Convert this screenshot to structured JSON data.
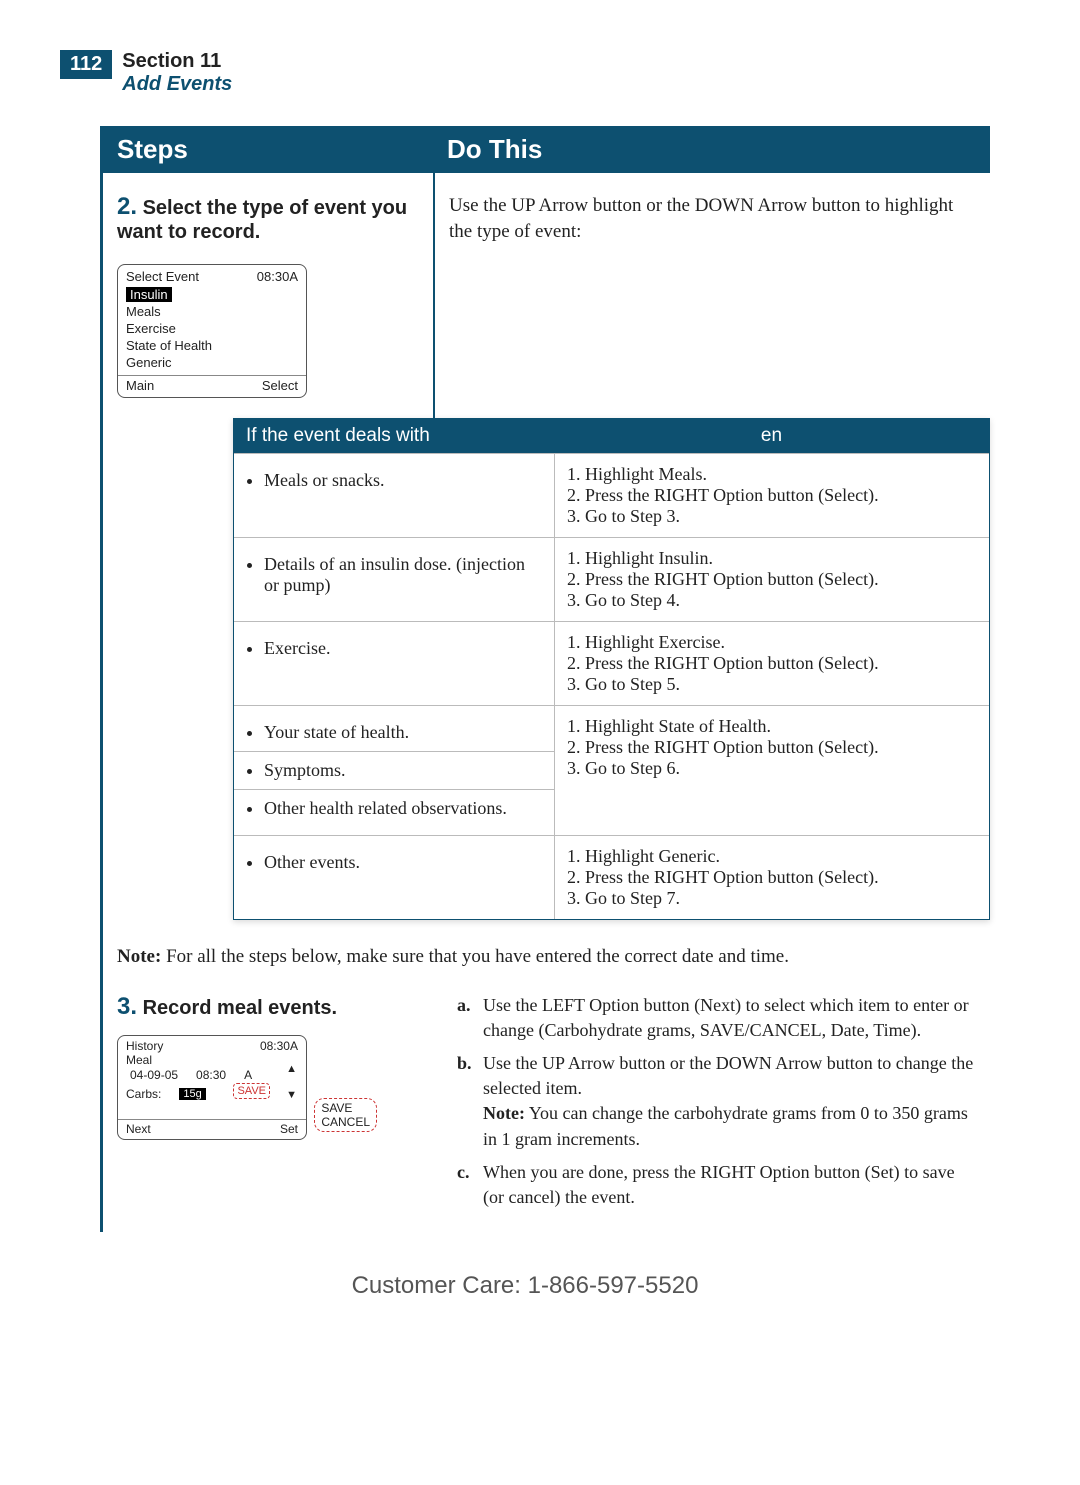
{
  "header": {
    "page_num": "112",
    "section": "Section 11",
    "subtitle": "Add Events"
  },
  "columns": {
    "left": "Steps",
    "right": "Do This"
  },
  "step2": {
    "num": "2.",
    "title": "Select the type of event you want to record.",
    "instruction": "Use the UP Arrow button or the DOWN Arrow button to highlight the type of event:",
    "screen": {
      "title": "Select Event",
      "time": "08:30A",
      "items": [
        "Insulin",
        "Meals",
        "Exercise",
        "State of Health",
        "Generic"
      ],
      "selected": "Insulin",
      "foot_left": "Main",
      "foot_right": "Select"
    }
  },
  "inner_table": {
    "head_left": "If the event deals with",
    "head_right": "en",
    "rows": [
      {
        "left_items": [
          "Meals or snacks."
        ],
        "right": "1. Highlight Meals.\n2. Press the RIGHT Option button (Select).\n3. Go to Step 3."
      },
      {
        "left_items": [
          "Details of an insulin dose. (injection or pump)"
        ],
        "right": "1. Highlight Insulin.\n2. Press the RIGHT Option button (Select).\n3. Go to Step 4."
      },
      {
        "left_items": [
          "Exercise."
        ],
        "right": "1. Highlight Exercise.\n2. Press the RIGHT  Option button (Select).\n3. Go to Step 5."
      },
      {
        "left_items": [
          "Your state of health.",
          "Symptoms.",
          "Other health related observations."
        ],
        "right": "1. Highlight State of Health.\n2. Press the RIGHT Option button (Select).\n3. Go to Step 6."
      },
      {
        "left_items": [
          "Other events."
        ],
        "right": "1. Highlight Generic.\n2. Press the RIGHT  Option button (Select).\n3. Go to Step 7."
      }
    ]
  },
  "note": {
    "label": "Note:",
    "text": "For all the steps below, make sure that you have entered the correct date and time."
  },
  "step3": {
    "num": "3.",
    "title": "Record meal events.",
    "screen": {
      "title": "History",
      "time": "08:30A",
      "line2": "Meal",
      "date": "04-09-05",
      "t2": "08:30",
      "ampm": "A",
      "carbs_label": "Carbs:",
      "carbs_val": "15g",
      "save_inner": "SAVE",
      "foot_left": "Next",
      "foot_right": "Set",
      "bubble1": "SAVE",
      "bubble2": "CANCEL"
    },
    "items": [
      {
        "lab": "a.",
        "text": "Use the LEFT Option button (Next) to select which item to enter or change (Carbohydrate grams, SAVE/CANCEL, Date, Time)."
      },
      {
        "lab": "b.",
        "text": "Use the UP Arrow button or the DOWN Arrow button to change the selected item.",
        "note_label": "Note:",
        "note": "You can change the carbohydrate grams from 0 to 350 grams in 1 gram increments."
      },
      {
        "lab": "c.",
        "text": "When you are done, press the RIGHT Option button (Set) to save (or cancel) the event."
      }
    ]
  },
  "footer": "Customer Care: 1-866-597-5520"
}
